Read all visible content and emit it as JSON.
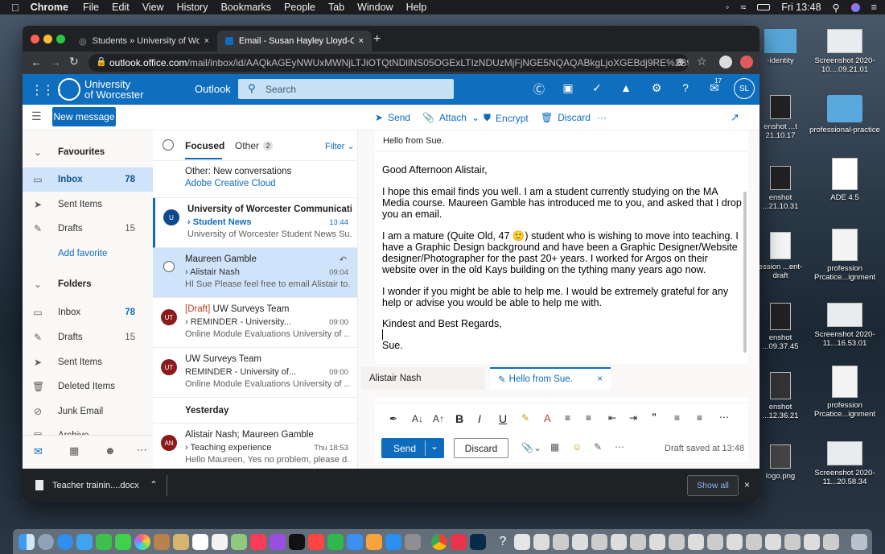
{
  "menubar": {
    "apple": "",
    "app": "Chrome",
    "items": [
      "File",
      "Edit",
      "View",
      "History",
      "Bookmarks",
      "People",
      "Tab",
      "Window",
      "Help"
    ],
    "clock": "Fri 13:48"
  },
  "desktop": [
    {
      "label": "-identity"
    },
    {
      "label": "Screenshot 2020-10....09.21.01"
    },
    {
      "label": "enshot ...t 21.10.17"
    },
    {
      "label": "professional-practice"
    },
    {
      "label": "enshot ...21.10.31"
    },
    {
      "label": "ADE 4.5"
    },
    {
      "label": "ession ...ent-draft"
    },
    {
      "label": "profession Prcatice...ignment"
    },
    {
      "label": "enshot ...09.37.45"
    },
    {
      "label": "Screenshot 2020-11...16.53.01"
    },
    {
      "label": "enshot ...12.36.21"
    },
    {
      "label": "profession Prcatice...ignment"
    },
    {
      "label": "logo.png"
    },
    {
      "label": "Screenshot 2020-11...20.58.34"
    }
  ],
  "browser": {
    "tabs": [
      {
        "title": "Students » University of Worce"
      },
      {
        "title": "Email - Susan Hayley Lloyd-Co"
      }
    ],
    "url_host": "outlook.office.com",
    "url_path": "/mail/inbox/id/AAQkAGEyNWUxMWNjLTJiOTQtNDllNS05OGExLTIzNDUzMjFjNGE5NQAQABkgLjoXGEBdj9RE%2B9AG0..."
  },
  "outlook": {
    "logo_line1": "University",
    "logo_line2": "of Worcester",
    "app_name": "Outlook",
    "search_placeholder": "Search",
    "badge": "17",
    "avatar": "SL"
  },
  "commandbar": {
    "new_message": "New message",
    "send": "Send",
    "attach": "Attach",
    "encrypt": "Encrypt",
    "discard": "Discard",
    "more": "···"
  },
  "nav": {
    "favourites": "Favourites",
    "fav_items": [
      {
        "label": "Inbox",
        "count": "78"
      },
      {
        "label": "Sent Items",
        "count": ""
      },
      {
        "label": "Drafts",
        "count": "15"
      }
    ],
    "add_favorite": "Add favorite",
    "folders": "Folders",
    "folder_items": [
      {
        "label": "Inbox",
        "count": "78"
      },
      {
        "label": "Drafts",
        "count": "15"
      },
      {
        "label": "Sent Items",
        "count": ""
      },
      {
        "label": "Deleted Items",
        "count": ""
      },
      {
        "label": "Junk Email",
        "count": ""
      },
      {
        "label": "Archive",
        "count": ""
      }
    ]
  },
  "list": {
    "tab_focused": "Focused",
    "tab_other": "Other",
    "other_count": "2",
    "filter": "Filter",
    "banner_title": "Other: New conversations",
    "banner_link": "Adobe Creative Cloud",
    "yesterday": "Yesterday",
    "messages": [
      {
        "avatar": "U",
        "from": "University of Worcester Communicatio...",
        "subject": "Student News",
        "time": "13:44",
        "preview": "University of Worcester Student News Su..."
      },
      {
        "avatar": "",
        "from": "Maureen Gamble",
        "subject": "Alistair Nash",
        "time": "09:04",
        "preview": "HI Sue Please feel free to email Alistair to..."
      },
      {
        "avatar": "UT",
        "draft": "[Draft]",
        "from": " UW Surveys Team",
        "subject": "REMINDER - University...",
        "time": "09:00",
        "preview": "Online Module Evaluations University of ..."
      },
      {
        "avatar": "UT",
        "from": "UW Surveys Team",
        "subject": "REMINDER - University of...",
        "time": "09:00",
        "preview": "Online Module Evaluations University of ..."
      },
      {
        "avatar": "AN",
        "from": "Alistair Nash; Maureen Gamble",
        "subject": "Teaching experience",
        "time": "Thu 18:53",
        "preview": "Hello Maureen, Yes no problem, please d..."
      }
    ]
  },
  "compose": {
    "subject": "Hello from Sue.",
    "greeting": "Good Afternoon Alistair,",
    "p1": "I hope this email finds you well. I am a student currently studying on the MA Media course. Maureen Gamble has introduced me to you, and asked that I drop you an email.",
    "p2": "I am a mature (Quite Old, 47 🙂) student who is wishing to move into teaching. I have a Graphic Design background and have been a Graphic Designer/Website designer/Photographer for the past 20+ years. I worked for Argos on their website over in the old Kays building on the tything many years ago now.",
    "p3": "I wonder if you might be able to help me. I would be extremely grateful for any help or advise you would be able to help me with.",
    "closing": "Kindest and Best Regards,",
    "sign": "Sue.",
    "send": "Send",
    "discard": "Discard",
    "draft_saved": "Draft saved at 13:48"
  },
  "bottomtabs": {
    "tab1": "Alistair Nash",
    "tab2": "Hello from Sue."
  },
  "downloads": {
    "file": "Teacher trainin....docx",
    "show_all": "Show all"
  },
  "colors": {
    "brand": "#106ebe",
    "accent": "#0f6cbd",
    "selected": "#cfe4fa"
  }
}
